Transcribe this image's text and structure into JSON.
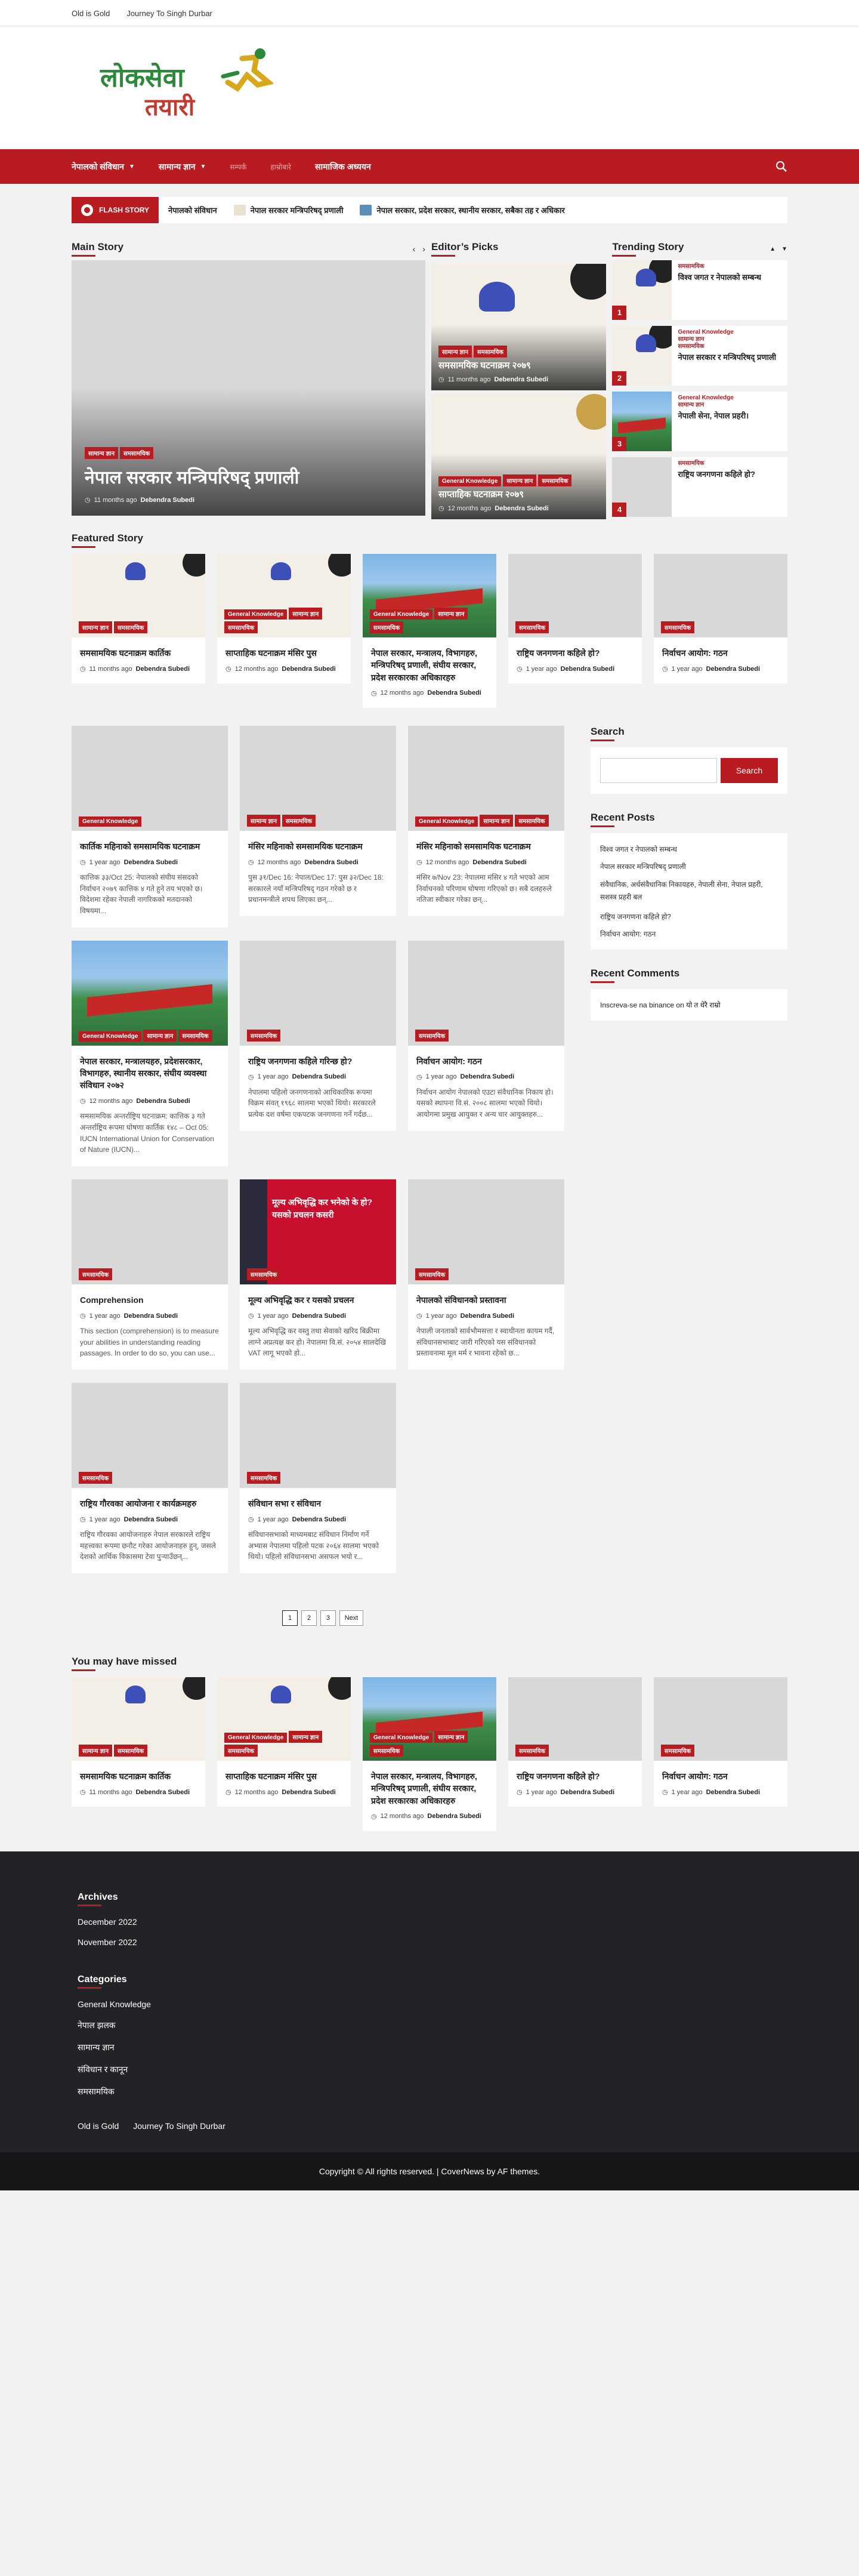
{
  "topbar": {
    "links": [
      "Old is Gold",
      "Journey To Singh Durbar"
    ]
  },
  "logo": {
    "line1": "लोकसेवा",
    "line2": "तयारी"
  },
  "nav": {
    "items": [
      "नेपालको संविधान",
      "सामान्य ज्ञान",
      "सम्पर्क",
      "हाम्रोबारे",
      "सामाजिक अध्ययन"
    ]
  },
  "flash": {
    "label": "FLASH STORY",
    "items": [
      "नेपालको संविधान",
      "नेपाल सरकार मन्त्रिपरिषद् प्रणाली",
      "नेपाल सरकार, प्रदेश सरकार, स्थानीय सरकार, सबैका तह र अधिकार"
    ]
  },
  "sections": {
    "main": "Main Story",
    "editor": "Editor’s Picks",
    "trending": "Trending Story",
    "featured": "Featured Story",
    "missed": "You may have missed",
    "search": "Search",
    "recent_posts": "Recent Posts",
    "recent_comments": "Recent Comments"
  },
  "cats": {
    "gk": "General Knowledge",
    "a": "समसामयिक",
    "b": "सामान्य ज्ञान",
    "c": "सम्पादकीय"
  },
  "common": {
    "author": "Debendra Subedi",
    "t11": "11 months ago",
    "t12": "12 months ago",
    "t1y": "1 year ago",
    "search_btn": "Search"
  },
  "main_story": {
    "title": "नेपाल सरकार मन्त्रिपरिषद् प्रणाली"
  },
  "editor": [
    {
      "title": "समसामयिक घटनाक्रम २०७९"
    },
    {
      "title": "साप्ताहिक घटनाक्रम २०७९"
    }
  ],
  "trending": [
    {
      "num": "1",
      "title": "विश्व जगत र नेपालको सम्बन्ध"
    },
    {
      "num": "2",
      "title": "नेपाल सरकार र मन्त्रिपरिषद् प्रणाली"
    },
    {
      "num": "3",
      "title": "नेपाली सेना, नेपाल प्रहरी।"
    },
    {
      "num": "4",
      "title": "राष्ट्रिय जनगणना कहिले हो?"
    }
  ],
  "featured": [
    {
      "title": "समसामयिक घटनाक्रम कार्तिक",
      "time": "11 months ago"
    },
    {
      "title": "साप्ताहिक घटनाक्रम मंसिर पुस",
      "time": "12 months ago"
    },
    {
      "title": "नेपाल सरकार, मन्त्रालय, विभागहरु, मन्त्रिपरिषद् प्रणाली, संघीय सरकार, प्रदेश सरकारका अधिकारहरु",
      "time": "12 months ago"
    },
    {
      "title": "राष्ट्रिय जनगणना कहिले हो?",
      "time": "1 year ago"
    },
    {
      "title": "निर्वाचन आयोग: गठन",
      "time": "1 year ago"
    }
  ],
  "grid": [
    {
      "title": "कार्तिक महिनाको समसामयिक घटनाक्रम",
      "time": "1 year ago",
      "excerpt": "कात्तिक ३३/Oct 25: नेपालको संघीय संसदको निर्वाचन २०७९ कात्तिक ४ गते हुने तय भएको छ। विदेशमा रहेका नेपाली नागरिकको मतदानको विषयमा..."
    },
    {
      "title": "मंसिर महिनाको समसामयिक घटनाक्रम",
      "time": "12 months ago",
      "excerpt": "पुस ३१/Dec 16: नेपाल/Dec 17: पुस ३२/Dec 18: सरकारले नयाँ मन्त्रिपरिषद् गठन गरेको छ र प्रधानमन्त्रीले शपथ लिएका छन्..."
    },
    {
      "title": "मंसिर महिनाको समसामयिक घटनाक्रम",
      "time": "12 months ago",
      "excerpt": "मंसिर ७/Nov 23: नेपालमा मंसिर ४ गते भएको आम निर्वाचनको परिणाम घोषणा गरिएको छ। सबै दलहरुले नतिजा स्वीकार गरेका छन्..."
    },
    {
      "title": "नेपाल सरकार, मन्त्रालयहरु, प्रदेशसरकार, विभागहरु, स्थानीय सरकार, संघीय व्यवस्था संविधान २०७२",
      "time": "12 months ago",
      "excerpt": "समसामयिक अन्तर्राष्ट्रिय घटनाक्रम: कात्तिक ३ गते अन्तर्राष्ट्रिय रूपमा घोषणा कार्तिक १४८ – Oct 05: IUCN International Union for Conservation of Nature (IUCN)..."
    },
    {
      "title": "राष्ट्रिय जनगणना कहिले गरिन्छ हो?",
      "time": "1 year ago",
      "excerpt": "नेपालमा पहिलो जनगणनाको आधिकारिक रूपमा विक्रम संवत् १९६८ सालमा भएको थियो। सरकारले प्रत्येक दश वर्षमा एकपटक जनगणना गर्ने गर्दछ..."
    },
    {
      "title": "निर्वाचन आयोग: गठन",
      "time": "1 year ago",
      "excerpt": "निर्वाचन आयोग नेपालको एउटा संवैधानिक निकाय हो। यसको स्थापना वि.सं. २००८ सालमा भएको थियो। आयोगमा प्रमुख आयुक्त र अन्य चार आयुक्तहरु..."
    },
    {
      "title": "Comprehension",
      "time": "1 year ago",
      "excerpt": "This section (comprehension) is to measure your abilities in understanding reading passages. In order to do so, you can use..."
    },
    {
      "title": "मूल्य अभिवृद्धि कर र यसको प्रचलन",
      "time": "1 year ago",
      "excerpt": "मूल्य अभिवृद्धि कर वस्तु तथा सेवाको खरिद बिक्रीमा लाग्ने अप्रत्यक्ष कर हो। नेपालमा वि.सं. २०५४ सालदेखि VAT लागू भएको हो..."
    },
    {
      "title": "नेपालको संविधानको प्रस्तावना",
      "time": "1 year ago",
      "excerpt": "नेपाली जनताको सार्वभौमसत्ता र स्वाधीनता कायम गर्दै, संविधानसभाबाट जारी गरिएको यस संविधानको प्रस्तावनामा मूल मर्म र भावना रहेको छ..."
    },
    {
      "title": "राष्ट्रिय गौरवका आयोजना र कार्यक्रमहरु",
      "time": "1 year ago",
      "excerpt": "राष्ट्रिय गौरवका आयोजनाहरु नेपाल सरकारले राष्ट्रिय महत्त्वका रूपमा छनौट गरेका आयोजनाहरु हुन्, जसले देशको आर्थिक विकासमा टेवा पुर्‍याउँछन्..."
    },
    {
      "title": "संविधान सभा र संविधान",
      "time": "1 year ago",
      "excerpt": "संविधानसभाको माध्यमबाट संविधान निर्माण गर्ने अभ्यास नेपालमा पहिलो पटक २०६४ सालमा भएको थियो। पहिलो संविधानसभा असफल भयो र..."
    }
  ],
  "pagination": [
    "1",
    "2",
    "3",
    "Next"
  ],
  "recent_posts": [
    "विश्व जगत र नेपालको सम्बन्ध",
    "नेपाल सरकार मन्त्रिपरिषद् प्रणाली",
    "संवैधानिक, अर्धसंवैधानिक निकायहरु, नेपाली सेना, नेपाल प्रहरी, सशस्त्र प्रहरी बल",
    "राष्ट्रिय जनगणना कहिले हो?",
    "निर्वाचन आयोग: गठन"
  ],
  "recent_comment": {
    "author": "Inscreva-se na binance",
    "on": "on",
    "post": "यो त धेरै राम्रो"
  },
  "vat": {
    "line1": "मूल्य अभिवृद्धि कर भनेको के हो?",
    "line2": "यसको प्रचलन कसरी"
  },
  "footer": {
    "archives_title": "Archives",
    "archives": [
      "December 2022",
      "November 2022"
    ],
    "categories_title": "Categories",
    "categories": [
      "General Knowledge",
      "नेपाल झलक",
      "सामान्य ज्ञान",
      "संविधान र कानून",
      "समसामयिक"
    ],
    "menu": [
      "Old is Gold",
      "Journey To Singh Durbar"
    ],
    "copyright": "Copyright © All rights reserved.",
    "theme": "CoverNews by AF themes."
  },
  "colors": {
    "accent": "#b81c21",
    "footer": "#222327"
  }
}
